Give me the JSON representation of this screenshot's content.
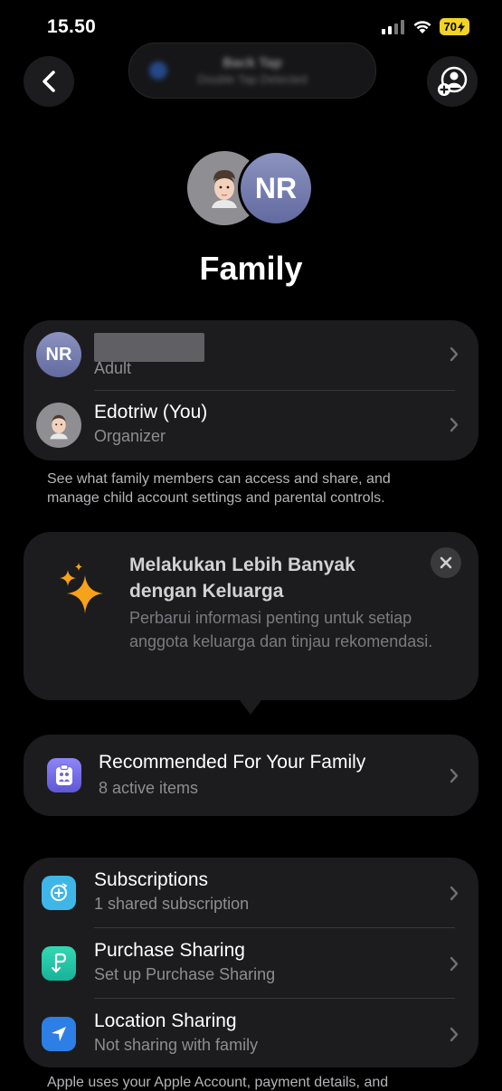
{
  "status_bar": {
    "time": "15.50",
    "battery": "70"
  },
  "island": {
    "title": "Back Tap",
    "subtitle": "Double Tap Detected"
  },
  "header": {
    "avatar_initials": "NR",
    "title": "Family"
  },
  "members": [
    {
      "initials": "NR",
      "name": "",
      "role": "Adult"
    },
    {
      "name": "Edotriw (You)",
      "role": "Organizer"
    }
  ],
  "members_footnote": "See what family members can access and share, and manage child account settings and parental controls.",
  "tip": {
    "title": "Melakukan Lebih Banyak dengan Keluarga",
    "body": "Perbarui informasi penting untuk setiap anggota keluarga dan tinjau rekomendasi."
  },
  "recommended": {
    "title": "Recommended For Your Family",
    "subtitle": "8 active items"
  },
  "features": [
    {
      "title": "Subscriptions",
      "subtitle": "1 shared subscription",
      "icon": "subscriptions-icon",
      "color": "#3fb6e8"
    },
    {
      "title": "Purchase Sharing",
      "subtitle": "Set up Purchase Sharing",
      "icon": "purchase-sharing-icon",
      "color": "#22c6a6"
    },
    {
      "title": "Location Sharing",
      "subtitle": "Not sharing with family",
      "icon": "location-arrow-icon",
      "color": "#2d7fe5"
    }
  ],
  "bottom_text": "Apple uses your Apple Account, payment details, and"
}
